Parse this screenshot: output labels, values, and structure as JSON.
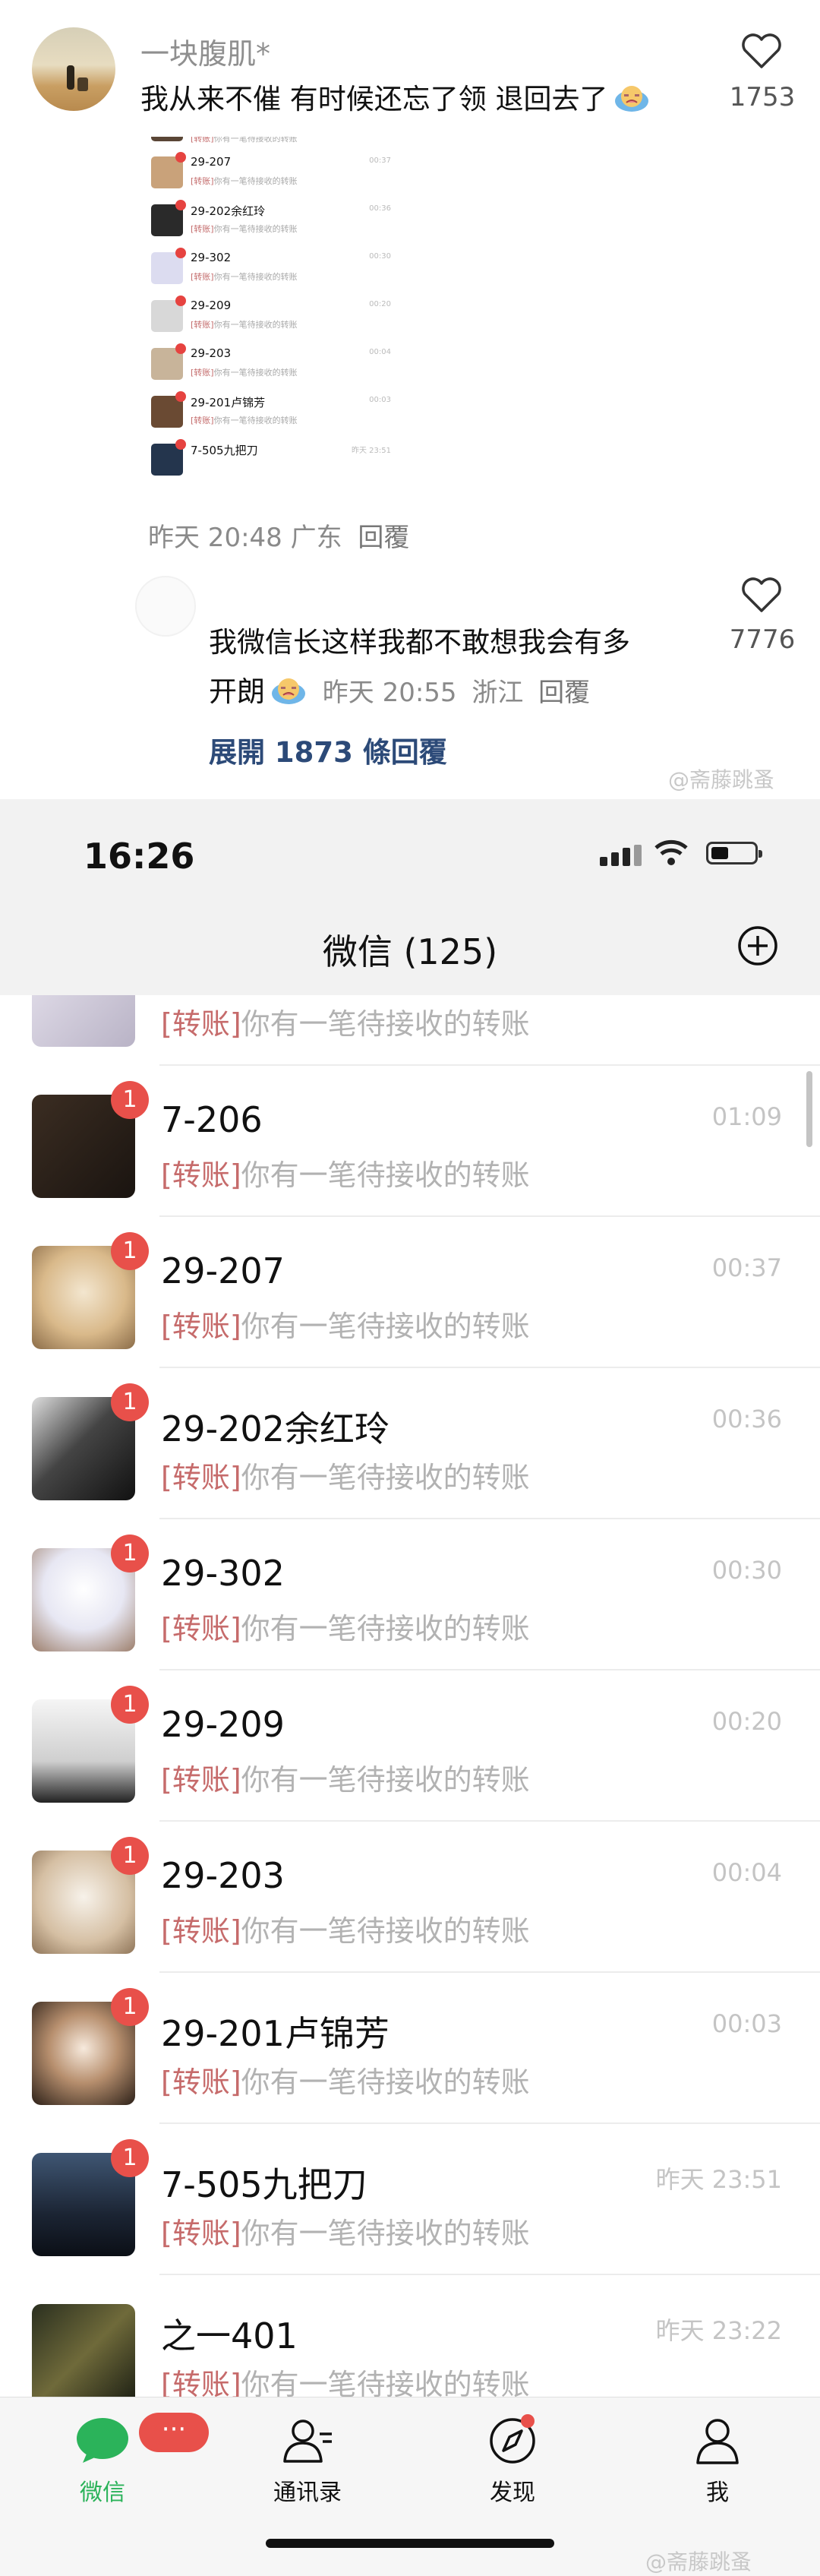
{
  "comment1": {
    "username": "一块腹肌*",
    "text": "我从来不催 有时候还忘了领 退回去了",
    "likes": "1753",
    "time": "昨天 20:48",
    "location": "广东",
    "reply_label": "回覆"
  },
  "thumbnail": {
    "rows": [
      {
        "title": "29-207",
        "msg_tag": "[转账]",
        "msg": "你有一笔待接收的转账",
        "time": "00:37"
      },
      {
        "title": "29-202余红玲",
        "msg_tag": "[转账]",
        "msg": "你有一笔待接收的转账",
        "time": "00:36"
      },
      {
        "title": "29-302",
        "msg_tag": "[转账]",
        "msg": "你有一笔待接收的转账",
        "time": "00:30"
      },
      {
        "title": "29-209",
        "msg_tag": "[转账]",
        "msg": "你有一笔待接收的转账",
        "time": "00:20"
      },
      {
        "title": "29-203",
        "msg_tag": "[转账]",
        "msg": "你有一笔待接收的转账",
        "time": "00:04"
      },
      {
        "title": "29-201卢锦芳",
        "msg_tag": "[转账]",
        "msg": "你有一笔待接收的转账",
        "time": "00:03"
      },
      {
        "title": "7-505九把刀",
        "msg_tag": "",
        "msg": "",
        "time": "昨天 23:51"
      }
    ]
  },
  "comment2": {
    "text_line1": "我微信长这样我都不敢想我会有多",
    "text_line2": "开朗",
    "likes": "7776",
    "time": "昨天 20:55",
    "location": "浙江",
    "reply_label": "回覆",
    "expand_label": "展開 1873 條回覆"
  },
  "watermark": "@斋藤跳蚤",
  "status_bar": {
    "time": "16:26"
  },
  "nav": {
    "title": "微信 (125)"
  },
  "chats": [
    {
      "name": "",
      "msg_tag": "[转账]",
      "msg": "你有一笔待接收的转账",
      "time": "",
      "badge": ""
    },
    {
      "name": "7-206",
      "msg_tag": "[转账]",
      "msg": "你有一笔待接收的转账",
      "time": "01:09",
      "badge": "1"
    },
    {
      "name": "29-207",
      "msg_tag": "[转账]",
      "msg": "你有一笔待接收的转账",
      "time": "00:37",
      "badge": "1"
    },
    {
      "name": "29-202余红玲",
      "msg_tag": "[转账]",
      "msg": "你有一笔待接收的转账",
      "time": "00:36",
      "badge": "1"
    },
    {
      "name": "29-302",
      "msg_tag": "[转账]",
      "msg": "你有一笔待接收的转账",
      "time": "00:30",
      "badge": "1"
    },
    {
      "name": "29-209",
      "msg_tag": "[转账]",
      "msg": "你有一笔待接收的转账",
      "time": "00:20",
      "badge": "1"
    },
    {
      "name": "29-203",
      "msg_tag": "[转账]",
      "msg": "你有一笔待接收的转账",
      "time": "00:04",
      "badge": "1"
    },
    {
      "name": "29-201卢锦芳",
      "msg_tag": "[转账]",
      "msg": "你有一笔待接收的转账",
      "time": "00:03",
      "badge": "1"
    },
    {
      "name": "7-505九把刀",
      "msg_tag": "[转账]",
      "msg": "你有一笔待接收的转账",
      "time": "昨天 23:51",
      "badge": "1"
    },
    {
      "name": "之一401",
      "msg_tag": "[转账]",
      "msg": "你有一笔待接收的转账",
      "time": "昨天 23:22",
      "badge": ""
    }
  ],
  "tabbar": {
    "chats_label": "微信",
    "chats_badge": "···",
    "contacts_label": "通讯录",
    "discover_label": "发现",
    "me_label": "我"
  },
  "colors": {
    "accent": "#2bb35a",
    "badge": "#e8504a",
    "tag": "#c66b6b"
  }
}
